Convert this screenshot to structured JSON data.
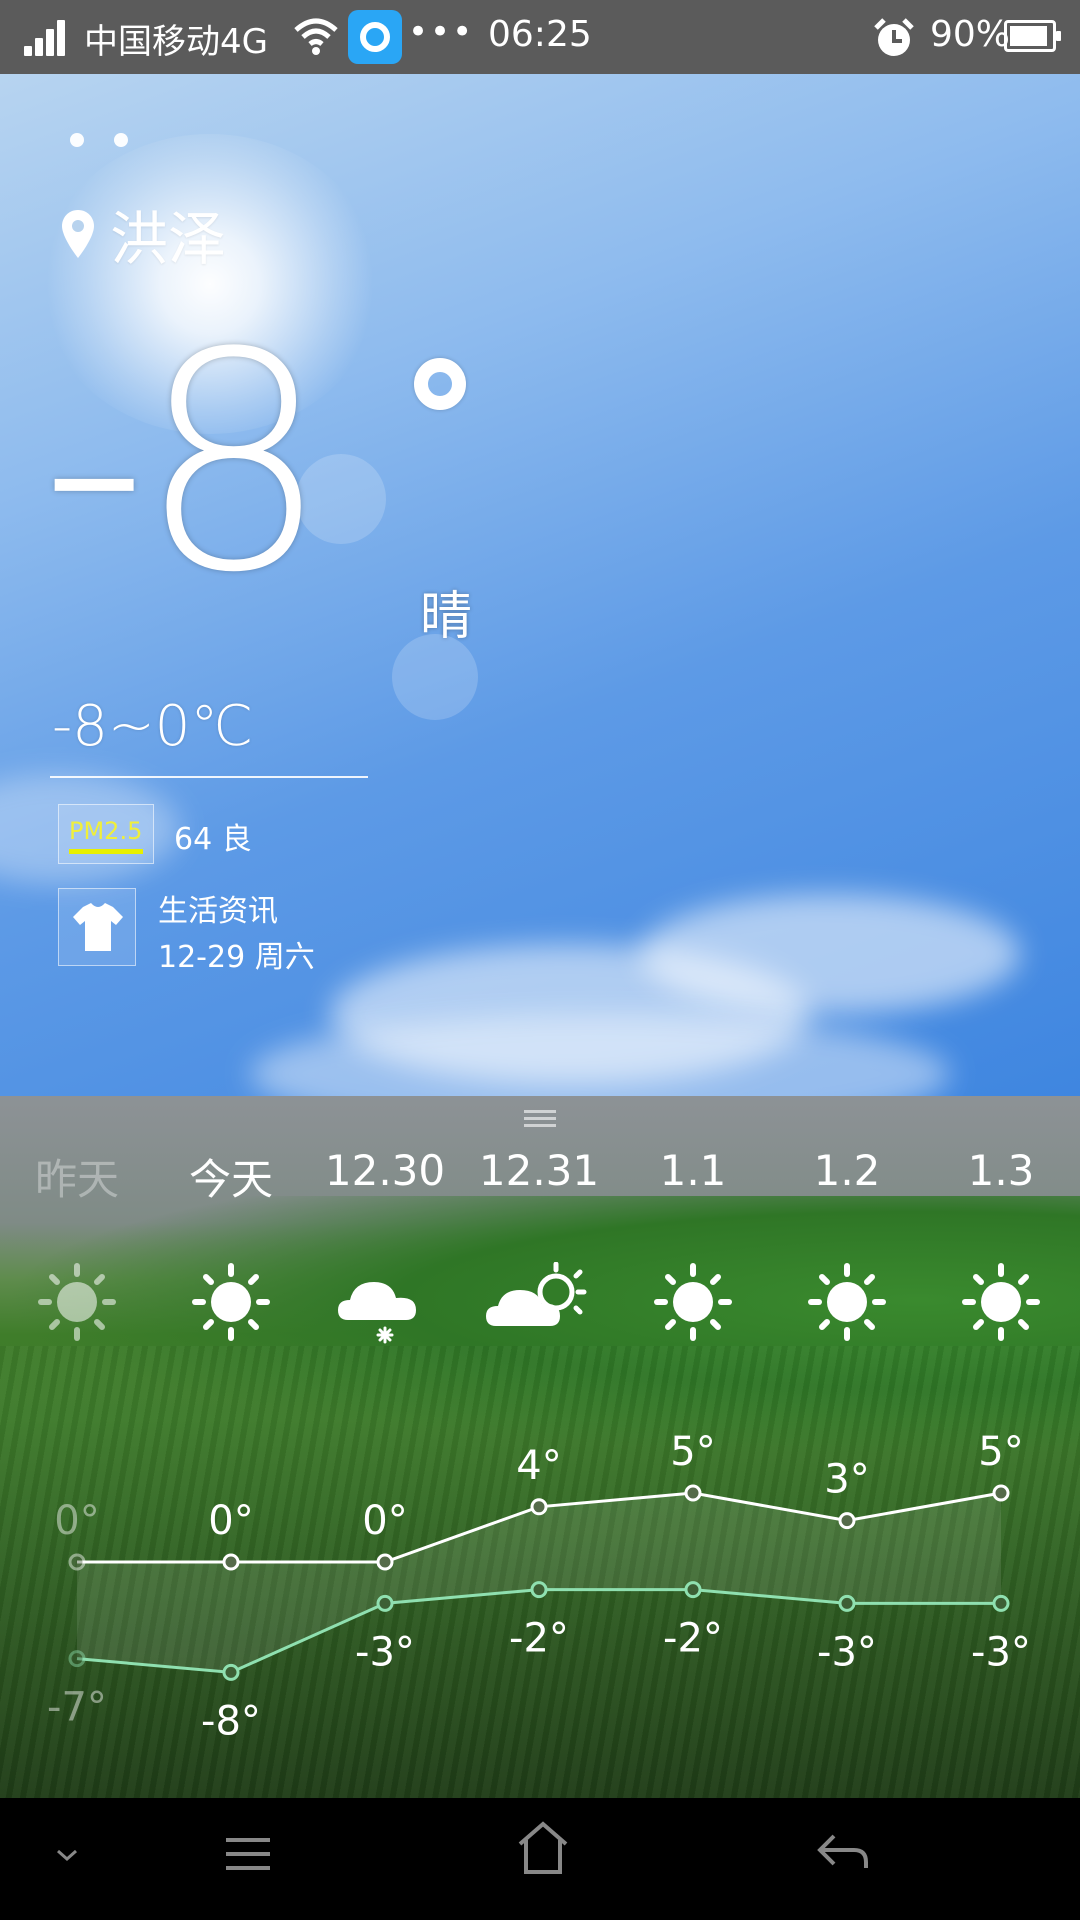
{
  "status_bar": {
    "carrier": "中国移动4G",
    "overflow": "•••",
    "time": "06:25",
    "battery": "90%",
    "icons": [
      "signal-icon",
      "wifi-icon",
      "app-notification-icon",
      "alarm-icon",
      "battery-icon"
    ]
  },
  "weather": {
    "city": "洪泽",
    "current_temp": "-8",
    "condition": "晴",
    "range": "-8~0℃",
    "pm25_label": "PM2.5",
    "pm25_value": "64 良",
    "life_title": "生活资讯",
    "life_date": "12-29 周六"
  },
  "forecast": {
    "days": [
      {
        "label": "昨天",
        "icon": "sun-icon",
        "high": "0°",
        "low": "-7°",
        "dim": true
      },
      {
        "label": "今天",
        "icon": "sun-icon",
        "high": "0°",
        "low": "-8°",
        "dim": false
      },
      {
        "label": "12.30",
        "icon": "snow-cloud-icon",
        "high": "0°",
        "low": "-3°",
        "dim": false
      },
      {
        "label": "12.31",
        "icon": "partly-cloudy-icon",
        "high": "4°",
        "low": "-2°",
        "dim": false
      },
      {
        "label": "1.1",
        "icon": "sun-icon",
        "high": "5°",
        "low": "-2°",
        "dim": false
      },
      {
        "label": "1.2",
        "icon": "sun-icon",
        "high": "3°",
        "low": "-3°",
        "dim": false
      },
      {
        "label": "1.3",
        "icon": "sun-icon",
        "high": "5°",
        "low": "-3°",
        "dim": false
      }
    ]
  },
  "chart_data": {
    "type": "line",
    "categories": [
      "昨天",
      "今天",
      "12.30",
      "12.31",
      "1.1",
      "1.2",
      "1.3"
    ],
    "series": [
      {
        "values": [
          0,
          0,
          0,
          4,
          5,
          3,
          5
        ]
      },
      {
        "values": [
          -7,
          -8,
          -3,
          -2,
          -2,
          -3,
          -3
        ]
      }
    ],
    "colors": {
      "high": "#ffffff",
      "low": "#8fe0b0"
    }
  },
  "nav": {
    "icons": [
      "chevron-down-icon",
      "menu-icon",
      "home-icon",
      "back-icon"
    ]
  }
}
